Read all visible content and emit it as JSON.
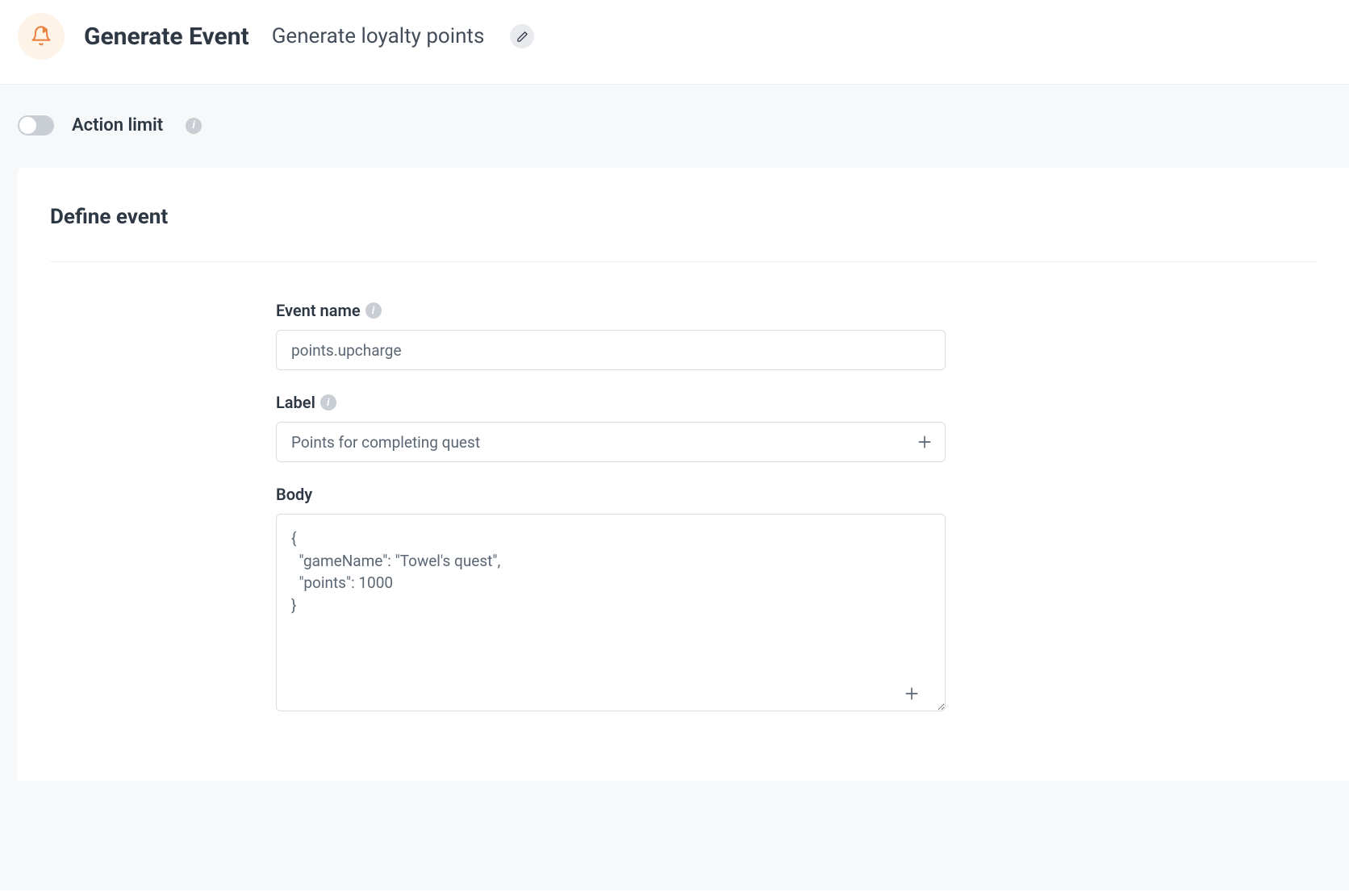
{
  "header": {
    "title": "Generate Event",
    "subtitle": "Generate loyalty points"
  },
  "action_limit": {
    "label": "Action limit",
    "enabled": false
  },
  "card": {
    "title": "Define event"
  },
  "form": {
    "event_name": {
      "label": "Event name",
      "value": "points.upcharge"
    },
    "event_label": {
      "label": "Label",
      "value": "Points for completing quest"
    },
    "body": {
      "label": "Body",
      "value": "{\n  \"gameName\": \"Towel's quest\",\n  \"points\": 1000\n}"
    }
  }
}
